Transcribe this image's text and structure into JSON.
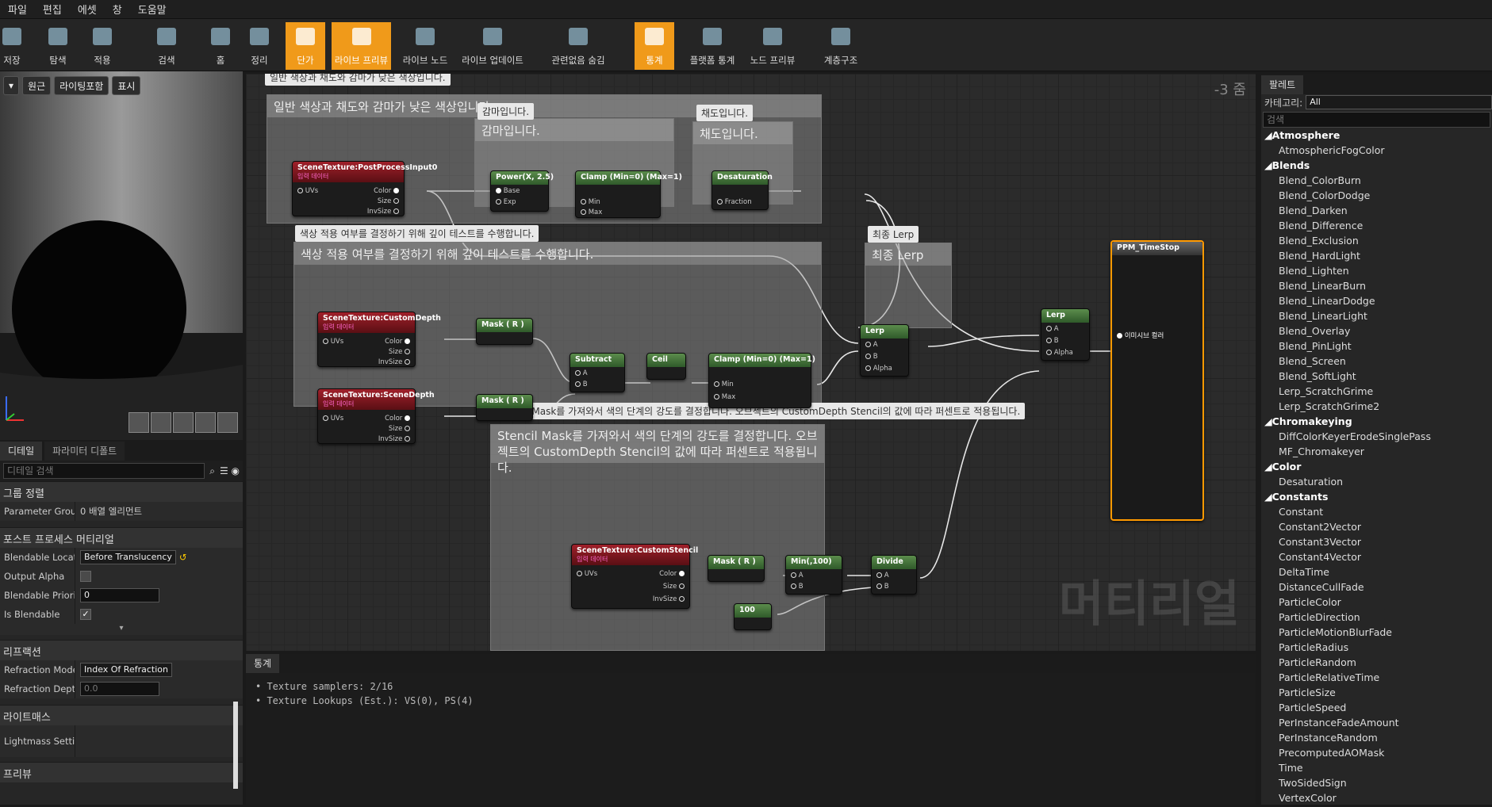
{
  "menu": [
    "파일",
    "편집",
    "에셋",
    "창",
    "도움말"
  ],
  "toolbar": {
    "items": [
      {
        "label": "저장",
        "icon": "save-icon",
        "active": false
      },
      {
        "label": "탐색",
        "icon": "browse-icon",
        "active": false
      },
      {
        "label": "적용",
        "icon": "apply-icon",
        "active": false
      },
      {
        "label": "검색",
        "icon": "search-icon",
        "active": false
      },
      {
        "label": "홈",
        "icon": "home-icon",
        "active": false
      },
      {
        "label": "정리",
        "icon": "clean-icon",
        "active": false
      },
      {
        "label": "단가",
        "icon": "stats-cost-icon",
        "active": true
      },
      {
        "label": "라이브 프리뷰",
        "icon": "live-preview-icon",
        "active": true
      },
      {
        "label": "라이브 노드",
        "icon": "live-nodes-icon",
        "active": false
      },
      {
        "label": "라이브 업데이트",
        "icon": "live-update-icon",
        "active": false
      },
      {
        "label": "관련없음 숨김",
        "icon": "hide-unrelated-icon",
        "active": false
      },
      {
        "label": "통계",
        "icon": "stats-icon",
        "active": true
      },
      {
        "label": "플랫폼 통계",
        "icon": "platform-stats-icon",
        "active": false
      },
      {
        "label": "노드 프리뷰",
        "icon": "node-preview-icon",
        "active": false
      },
      {
        "label": "계층구조",
        "icon": "hierarchy-icon",
        "active": false
      }
    ]
  },
  "viewport": {
    "buttons": [
      "원근",
      "라이팅포함",
      "표시"
    ]
  },
  "details": {
    "tabs": [
      "디테일",
      "파라미터 디폴트"
    ],
    "search_placeholder": "디테일 검색",
    "group_sort": "그룹 정렬",
    "param_group_label": "Parameter Group",
    "param_group_value": "0 배열 엘리먼트",
    "postprocess_title": "포스트 프로세스 머티리얼",
    "blendable_location_label": "Blendable Locatic",
    "blendable_location_value": "Before Translucency",
    "output_alpha_label": "Output Alpha",
    "blendable_priority_label": "Blendable Priority",
    "blendable_priority_value": "0",
    "is_blendable_label": "Is Blendable",
    "refraction_title": "리프랙션",
    "refraction_mode_label": "Refraction Mode",
    "refraction_mode_value": "Index Of Refraction",
    "refraction_depth_label": "Refraction Depth",
    "refraction_depth_value": "0.0",
    "lightmass_title": "라이트매스",
    "lightmass_settings_label": "Lightmass Settin",
    "preview_title": "프리뷰"
  },
  "graph": {
    "zoom": "-3 줌",
    "watermark": "머티리얼",
    "comments": {
      "c1_bubble": "일반 색상과 채도와 감마가 낮은 색상입니다.",
      "c1_title": "일반 색상과 채도와 감마가 낮은 색상입니다.",
      "gamma_bubble": "감마입니다.",
      "gamma_title": "감마입니다.",
      "sat_bubble": "채도입니다.",
      "sat_title": "채도입니다.",
      "depth_bubble": "색상 적용 여부를 결정하기 위해 깊이 테스트를 수행합니다.",
      "depth_title": "색상 적용 여부를 결정하기 위해 깊이 테스트를 수행합니다.",
      "lerp_bubble": "최종 Lerp",
      "lerp_title": "최종 Lerp",
      "stencil_bubble": "Stencil Mask를 가져와서 색의 단계의 강도를 결정합니다. 오브젝트의 CustomDepth Stencil의 값에 따라 퍼센트로 적용됩니다.",
      "stencil_title": "Stencil Mask를 가져와서 색의 단계의 강도를 결정합니다. 오브젝트의 CustomDepth Stencil의 값에 따라 퍼센트로 적용됩니다."
    },
    "nodes": {
      "scene_pp": "SceneTexture:PostProcessInput0",
      "scene_cd": "SceneTexture:CustomDepth",
      "scene_sd": "SceneTexture:SceneDepth",
      "scene_cs": "SceneTexture:CustomStencil",
      "input_sub": "입력 데이터",
      "power": "Power(X, 2.5)",
      "clamp1": "Clamp (Min=0) (Max=1)",
      "desat": "Desaturation",
      "mask_r1": "Mask ( R )",
      "mask_r2": "Mask ( R )",
      "mask_r3": "Mask ( R )",
      "subtract": "Subtract",
      "ceil": "Ceil",
      "clamp2": "Clamp (Min=0) (Max=1)",
      "lerp1": "Lerp",
      "lerp2": "Lerp",
      "min100": "Min(,100)",
      "divide": "Divide",
      "const100": "100",
      "result": "PPM_TimeStop",
      "emissive": "이미시브 컬러"
    },
    "pins": {
      "uvs": "UVs",
      "color": "Color",
      "size": "Size",
      "invsize": "InvSize",
      "base": "Base",
      "exp": "Exp",
      "min": "Min",
      "max": "Max",
      "fraction": "Fraction",
      "a": "A",
      "b": "B",
      "alpha": "Alpha"
    }
  },
  "stats": {
    "tab": "통계",
    "lines": [
      "Texture samplers: 2/16",
      "Texture Lookups (Est.): VS(0), PS(4)"
    ]
  },
  "palette": {
    "tab": "팔레트",
    "category_label": "카테고리:",
    "category_value": "All",
    "search_placeholder": "검색",
    "groups": [
      {
        "name": "Atmosphere",
        "items": [
          "AtmosphericFogColor"
        ]
      },
      {
        "name": "Blends",
        "items": [
          "Blend_ColorBurn",
          "Blend_ColorDodge",
          "Blend_Darken",
          "Blend_Difference",
          "Blend_Exclusion",
          "Blend_HardLight",
          "Blend_Lighten",
          "Blend_LinearBurn",
          "Blend_LinearDodge",
          "Blend_LinearLight",
          "Blend_Overlay",
          "Blend_PinLight",
          "Blend_Screen",
          "Blend_SoftLight",
          "Lerp_ScratchGrime",
          "Lerp_ScratchGrime2"
        ]
      },
      {
        "name": "Chromakeying",
        "items": [
          "DiffColorKeyerErodeSinglePass",
          "MF_Chromakeyer"
        ]
      },
      {
        "name": "Color",
        "items": [
          "Desaturation"
        ]
      },
      {
        "name": "Constants",
        "items": [
          "Constant",
          "Constant2Vector",
          "Constant3Vector",
          "Constant4Vector",
          "DeltaTime",
          "DistanceCullFade",
          "ParticleColor",
          "ParticleDirection",
          "ParticleMotionBlurFade",
          "ParticleRadius",
          "ParticleRandom",
          "ParticleRelativeTime",
          "ParticleSize",
          "ParticleSpeed",
          "PerInstanceFadeAmount",
          "PerInstanceRandom",
          "PrecomputedAOMask",
          "Time",
          "TwoSidedSign",
          "VertexColor"
        ]
      }
    ]
  }
}
